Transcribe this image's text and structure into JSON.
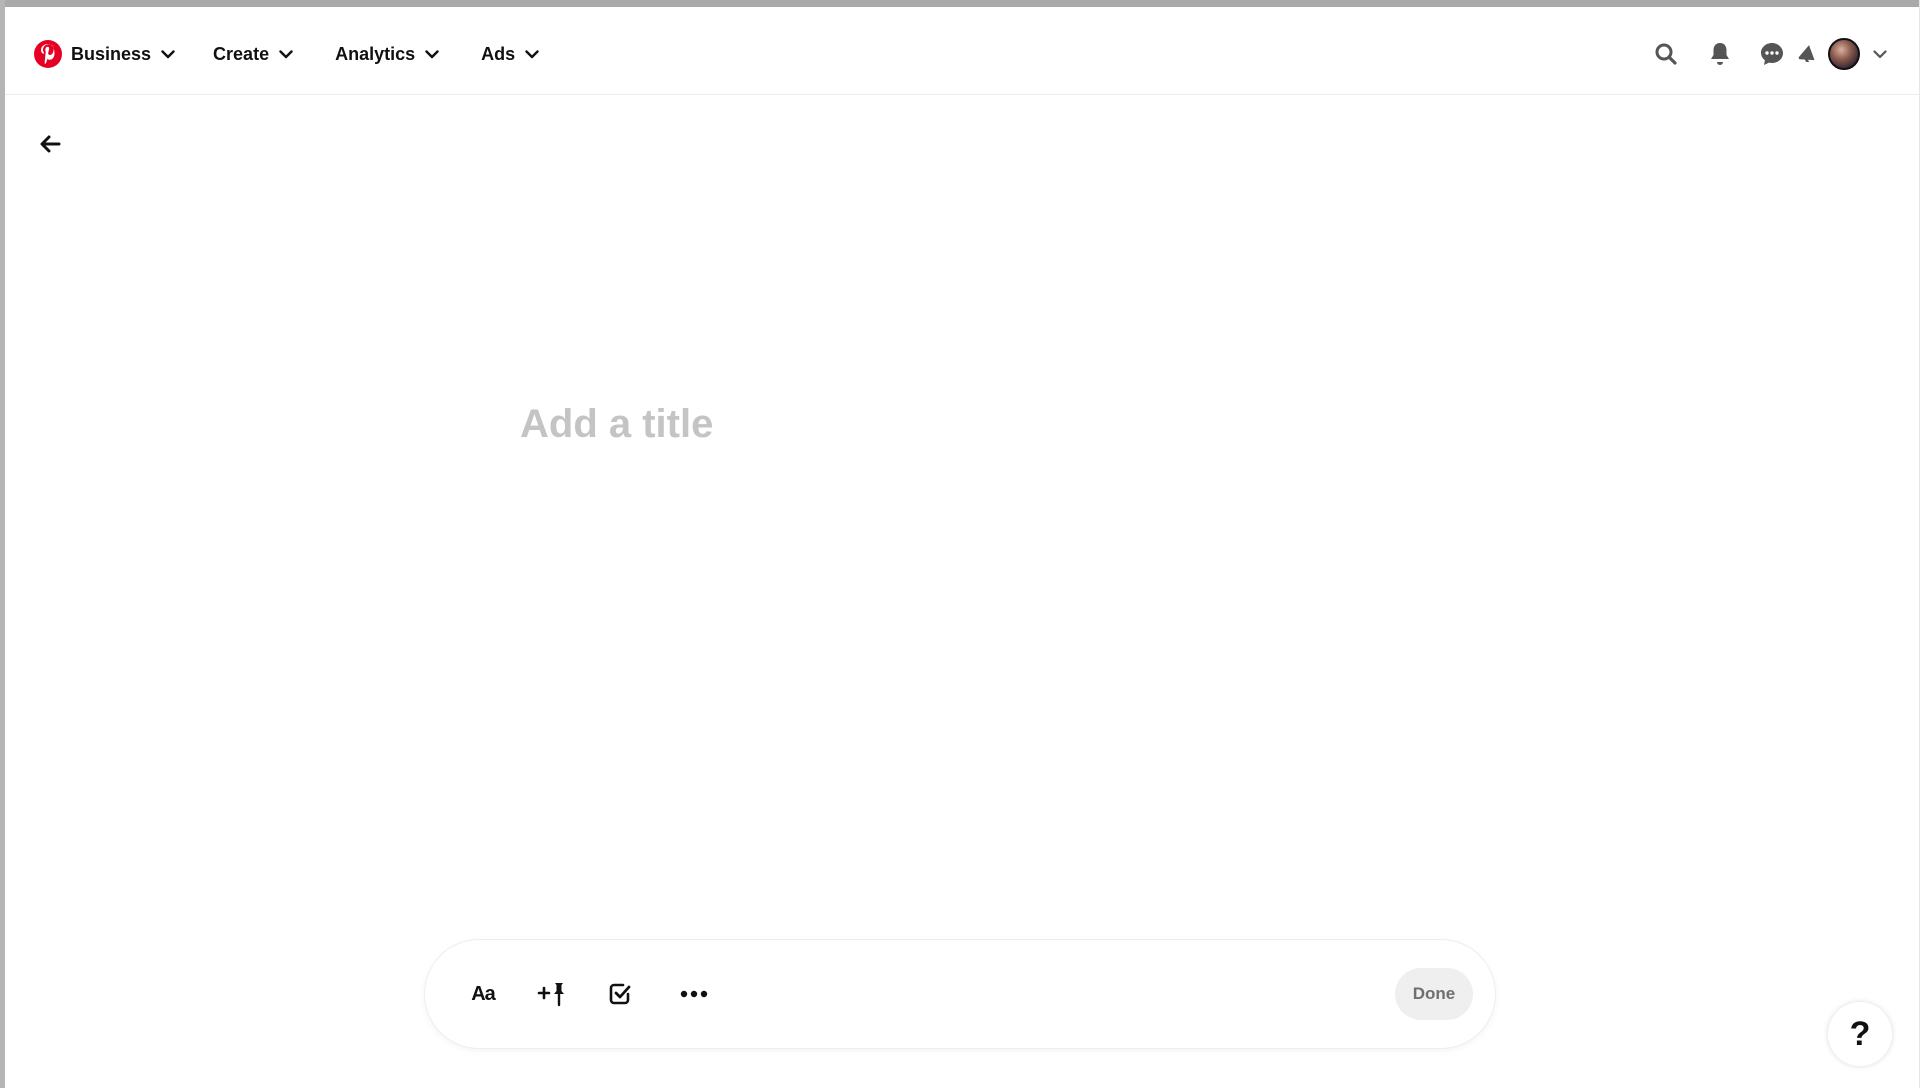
{
  "header": {
    "nav": [
      {
        "label": "Business"
      },
      {
        "label": "Create"
      },
      {
        "label": "Analytics"
      },
      {
        "label": "Ads"
      }
    ],
    "icons": [
      "search-icon",
      "bell-icon",
      "chat-icon",
      "megaphone-icon",
      "avatar",
      "chevron-down-icon"
    ]
  },
  "editor": {
    "title_placeholder": "Add a title",
    "title_value": ""
  },
  "toolbar": {
    "text_format_label": "Aa",
    "tools": [
      "add-pin-icon",
      "checklist-icon",
      "more-icon"
    ],
    "done_label": "Done"
  },
  "help": {
    "label": "?"
  },
  "colors": {
    "brand": "#e60023",
    "placeholder": "#c4c4c4",
    "done_bg": "#efefef",
    "done_text": "#6f6f6f"
  }
}
